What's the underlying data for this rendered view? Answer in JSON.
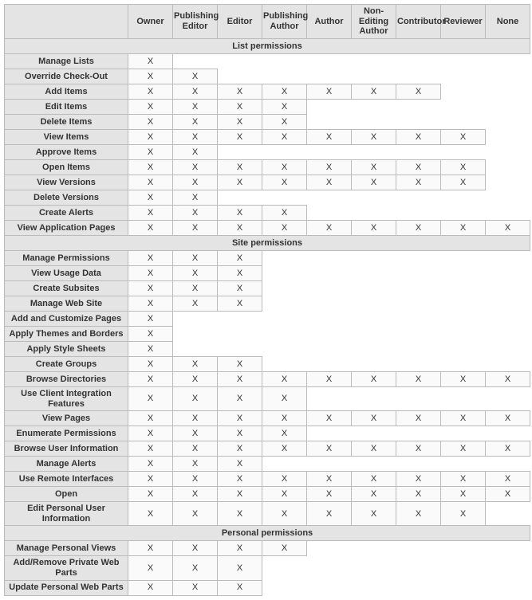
{
  "roles": [
    "Owner",
    "Publishing Editor",
    "Editor",
    "Publishing Author",
    "Author",
    "Non-Editing Author",
    "Contributor",
    "Reviewer",
    "None"
  ],
  "mark": "X",
  "sections": [
    {
      "title": "List permissions",
      "rows": [
        {
          "name": "Manage Lists",
          "grants": [
            1,
            0,
            0,
            0,
            0,
            0,
            0,
            0,
            0
          ]
        },
        {
          "name": "Override Check-Out",
          "grants": [
            1,
            1,
            0,
            0,
            0,
            0,
            0,
            0,
            0
          ]
        },
        {
          "name": "Add Items",
          "grants": [
            1,
            1,
            1,
            1,
            1,
            1,
            1,
            0,
            0
          ]
        },
        {
          "name": "Edit Items",
          "grants": [
            1,
            1,
            1,
            1,
            0,
            0,
            0,
            0,
            0
          ]
        },
        {
          "name": "Delete Items",
          "grants": [
            1,
            1,
            1,
            1,
            0,
            0,
            0,
            0,
            0
          ]
        },
        {
          "name": "View Items",
          "grants": [
            1,
            1,
            1,
            1,
            1,
            1,
            1,
            1,
            0
          ]
        },
        {
          "name": "Approve Items",
          "grants": [
            1,
            1,
            0,
            0,
            0,
            0,
            0,
            0,
            0
          ]
        },
        {
          "name": "Open Items",
          "grants": [
            1,
            1,
            1,
            1,
            1,
            1,
            1,
            1,
            0
          ]
        },
        {
          "name": "View Versions",
          "grants": [
            1,
            1,
            1,
            1,
            1,
            1,
            1,
            1,
            0
          ]
        },
        {
          "name": "Delete Versions",
          "grants": [
            1,
            1,
            0,
            0,
            0,
            0,
            0,
            0,
            0
          ]
        },
        {
          "name": "Create Alerts",
          "grants": [
            1,
            1,
            1,
            1,
            0,
            0,
            0,
            0,
            0
          ]
        },
        {
          "name": "View Application Pages",
          "grants": [
            1,
            1,
            1,
            1,
            1,
            1,
            1,
            1,
            1
          ]
        }
      ]
    },
    {
      "title": "Site permissions",
      "rows": [
        {
          "name": "Manage Permissions",
          "grants": [
            1,
            1,
            1,
            0,
            0,
            0,
            0,
            0,
            0
          ]
        },
        {
          "name": "View Usage Data",
          "grants": [
            1,
            1,
            1,
            0,
            0,
            0,
            0,
            0,
            0
          ]
        },
        {
          "name": "Create Subsites",
          "grants": [
            1,
            1,
            1,
            0,
            0,
            0,
            0,
            0,
            0
          ]
        },
        {
          "name": "Manage Web Site",
          "grants": [
            1,
            1,
            1,
            0,
            0,
            0,
            0,
            0,
            0
          ]
        },
        {
          "name": "Add and Customize Pages",
          "grants": [
            1,
            0,
            0,
            0,
            0,
            0,
            0,
            0,
            0
          ]
        },
        {
          "name": "Apply Themes and Borders",
          "grants": [
            1,
            0,
            0,
            0,
            0,
            0,
            0,
            0,
            0
          ]
        },
        {
          "name": "Apply Style Sheets",
          "grants": [
            1,
            0,
            0,
            0,
            0,
            0,
            0,
            0,
            0
          ]
        },
        {
          "name": "Create Groups",
          "grants": [
            1,
            1,
            1,
            0,
            0,
            0,
            0,
            0,
            0
          ]
        },
        {
          "name": "Browse Directories",
          "grants": [
            1,
            1,
            1,
            1,
            1,
            1,
            1,
            1,
            1
          ]
        },
        {
          "name": "Use Client Integration Features",
          "grants": [
            1,
            1,
            1,
            1,
            0,
            0,
            0,
            0,
            0
          ]
        },
        {
          "name": "View Pages",
          "grants": [
            1,
            1,
            1,
            1,
            1,
            1,
            1,
            1,
            1
          ]
        },
        {
          "name": "Enumerate Permissions",
          "grants": [
            1,
            1,
            1,
            1,
            0,
            0,
            0,
            0,
            0
          ]
        },
        {
          "name": "Browse User Information",
          "grants": [
            1,
            1,
            1,
            1,
            1,
            1,
            1,
            1,
            1
          ]
        },
        {
          "name": "Manage Alerts",
          "grants": [
            1,
            1,
            1,
            0,
            0,
            0,
            0,
            0,
            0
          ]
        },
        {
          "name": "Use Remote Interfaces",
          "grants": [
            1,
            1,
            1,
            1,
            1,
            1,
            1,
            1,
            1
          ]
        },
        {
          "name": "Open",
          "grants": [
            1,
            1,
            1,
            1,
            1,
            1,
            1,
            1,
            1
          ]
        },
        {
          "name": "Edit Personal User Information",
          "grants": [
            1,
            1,
            1,
            1,
            1,
            1,
            1,
            1,
            0
          ]
        }
      ]
    },
    {
      "title": "Personal permissions",
      "rows": [
        {
          "name": "Manage Personal Views",
          "grants": [
            1,
            1,
            1,
            1,
            0,
            0,
            0,
            0,
            0
          ]
        },
        {
          "name": "Add/Remove Private Web Parts",
          "grants": [
            1,
            1,
            1,
            0,
            0,
            0,
            0,
            0,
            0
          ]
        },
        {
          "name": "Update Personal Web Parts",
          "grants": [
            1,
            1,
            1,
            0,
            0,
            0,
            0,
            0,
            0
          ]
        }
      ]
    }
  ]
}
